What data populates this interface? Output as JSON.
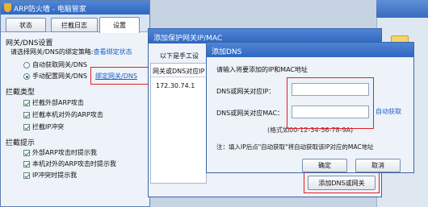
{
  "main_window": {
    "title": "ARP防火墙 - 电脑管家",
    "tabs": [
      "状态",
      "拦截日志",
      "设置"
    ],
    "section_gateway": "网关/DNS设置",
    "bind_prompt": "请选择网关/DNS的绑定策略:",
    "bind_link": "查看绑定状态",
    "radio_auto": "自动获取网关/DNS",
    "radio_manual": "手动配置网关/DNS",
    "bind_button": "绑定网关/DNS",
    "section_intercept": "拦截类型",
    "intercept_items": [
      "拦截外部ARP攻击",
      "拦截本机对外的ARP攻击",
      "拦截IP冲突"
    ],
    "section_notify": "拦截提示",
    "notify_items": [
      "外部ARP攻击时提示我",
      "本机对外的ARP攻击时提示我",
      "IP冲突时提示我"
    ]
  },
  "protect_dialog": {
    "title": "添加保护网关IP/MAC",
    "hint": "以下是手工设",
    "col_header": "网关或DNS对应IP",
    "row_ip": "172.30.74.1",
    "add_button": "添加DNS或网关"
  },
  "dns_dialog": {
    "title": "添加DNS",
    "instruction": "请输入将要添加的IP和MAC地址",
    "ip_label": "DNS或网关对应IP：",
    "mac_label": "DNS或网关对应MAC：",
    "ip_value": "",
    "mac_value": "",
    "auto_link": "自动获取",
    "format_hint": "(格式如00-12-34-56-78-9A)",
    "note": "注：填入IP后点\"自动获取\"将自动获取该IP对应的MAC地址",
    "ok_button": "确定",
    "cancel_button": "取消"
  }
}
